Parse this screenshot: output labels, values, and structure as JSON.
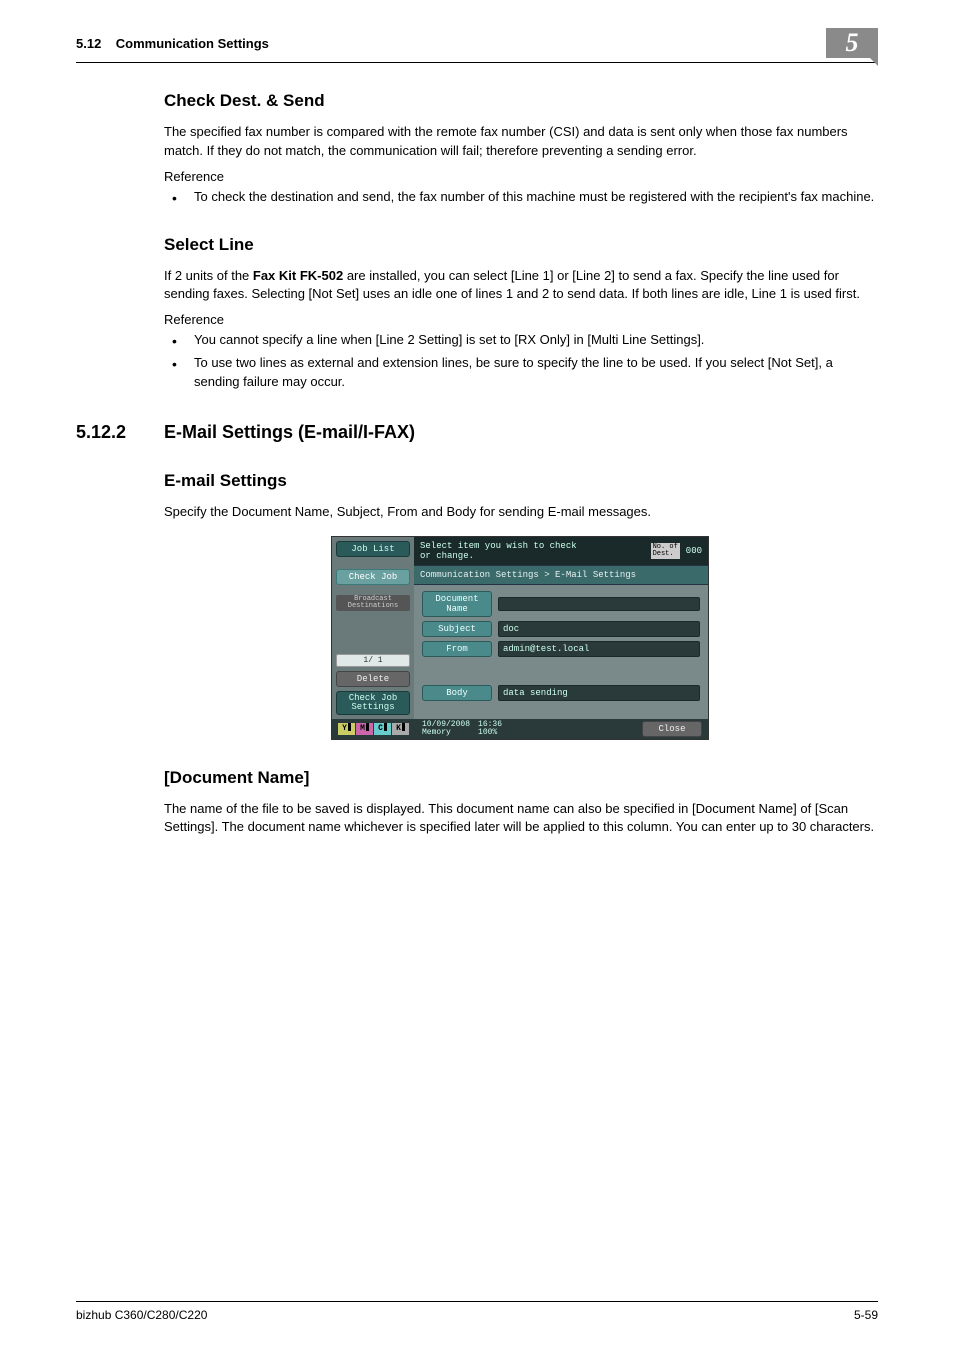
{
  "header": {
    "section_no": "5.12",
    "section_title": "Communication Settings",
    "chapter": "5"
  },
  "s1": {
    "heading": "Check Dest. & Send",
    "para": "The specified fax number is compared with the remote fax number (CSI) and data is sent only when those fax numbers match. If they do not match, the communication will fail; therefore preventing a sending error.",
    "ref_label": "Reference",
    "bullets": [
      "To check the destination and send, the fax number of this machine must be registered with the recipient's fax machine."
    ]
  },
  "s2": {
    "heading": "Select Line",
    "para_prefix": "If 2 units of the ",
    "para_bold": "Fax Kit FK-502",
    "para_suffix": " are installed, you can select [Line 1] or [Line 2] to send a fax. Specify the line used for sending faxes. Selecting [Not Set] uses an idle one of lines 1 and 2 to send data. If both lines are idle, Line 1 is used first.",
    "ref_label": "Reference",
    "bullets": [
      "You cannot specify a line when [Line 2 Setting] is set to [RX Only] in [Multi Line Settings].",
      "To use two lines as external and extension lines, be sure to specify the line to be used. If you select [Not Set], a sending failure may occur."
    ]
  },
  "s3": {
    "num": "5.12.2",
    "title": "E-Mail Settings (E-mail/I-FAX)"
  },
  "s4": {
    "heading": "E-mail Settings",
    "para": "Specify the Document Name, Subject, From and Body for sending E-mail messages."
  },
  "screenshot": {
    "left": {
      "job_list": "Job List",
      "check_job": "Check Job",
      "broadcast": "Broadcast\nDestinations",
      "page": "1/  1",
      "delete": "Delete",
      "check_settings": "Check Job\nSettings"
    },
    "top": {
      "msg_l1": "Select item you wish to check",
      "msg_l2": "or change.",
      "dest_label": "No. of\nDest.",
      "dest_count": "000"
    },
    "crumb": "Communication Settings > E-Mail Settings",
    "fields": {
      "doc_name_label": "Document Name",
      "doc_name_val": "",
      "subject_label": "Subject",
      "subject_val": "doc",
      "from_label": "From",
      "from_val": "admin@test.local",
      "body_label": "Body",
      "body_val": "data sending"
    },
    "footer": {
      "toners": [
        "Y",
        "M",
        "C",
        "K"
      ],
      "date": "10/09/2008",
      "time": "16:36",
      "mem_label": "Memory",
      "mem_val": "100%",
      "close": "Close"
    }
  },
  "s5": {
    "heading": "[Document Name]",
    "para": "The name of the file to be saved is displayed. This document name can also be specified in [Document Name] of [Scan Settings]. The document name whichever is specified later will be applied to this column. You can enter up to 30 characters."
  },
  "footer": {
    "left": "bizhub C360/C280/C220",
    "right": "5-59"
  }
}
